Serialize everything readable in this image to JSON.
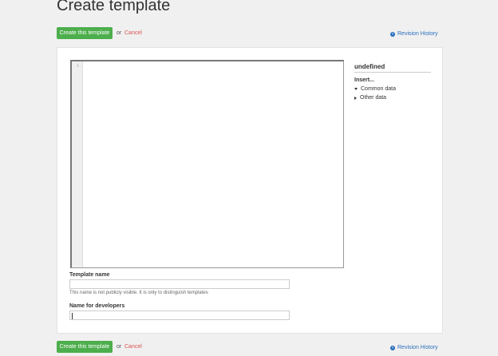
{
  "page": {
    "title": "Create template"
  },
  "actions": {
    "create_label": "Create this template",
    "or_text": "or",
    "cancel_label": "Cancel",
    "revision_history_label": "Revision History"
  },
  "editor": {
    "line_numbers": [
      "1."
    ]
  },
  "sidebar": {
    "title": "undefined",
    "insert_label": "Insert...",
    "items": [
      {
        "label": "Common data",
        "expanded": true
      },
      {
        "label": "Other data",
        "expanded": false
      }
    ]
  },
  "form": {
    "template_name": {
      "label": "Template name",
      "value": "",
      "help": "This name is not publicly visible. It is only to distinguish templates"
    },
    "developer_name": {
      "label": "Name for developers",
      "value": ""
    }
  },
  "colors": {
    "primary": "#4cae4c",
    "danger": "#d9534f",
    "link": "#2a6ebb"
  }
}
